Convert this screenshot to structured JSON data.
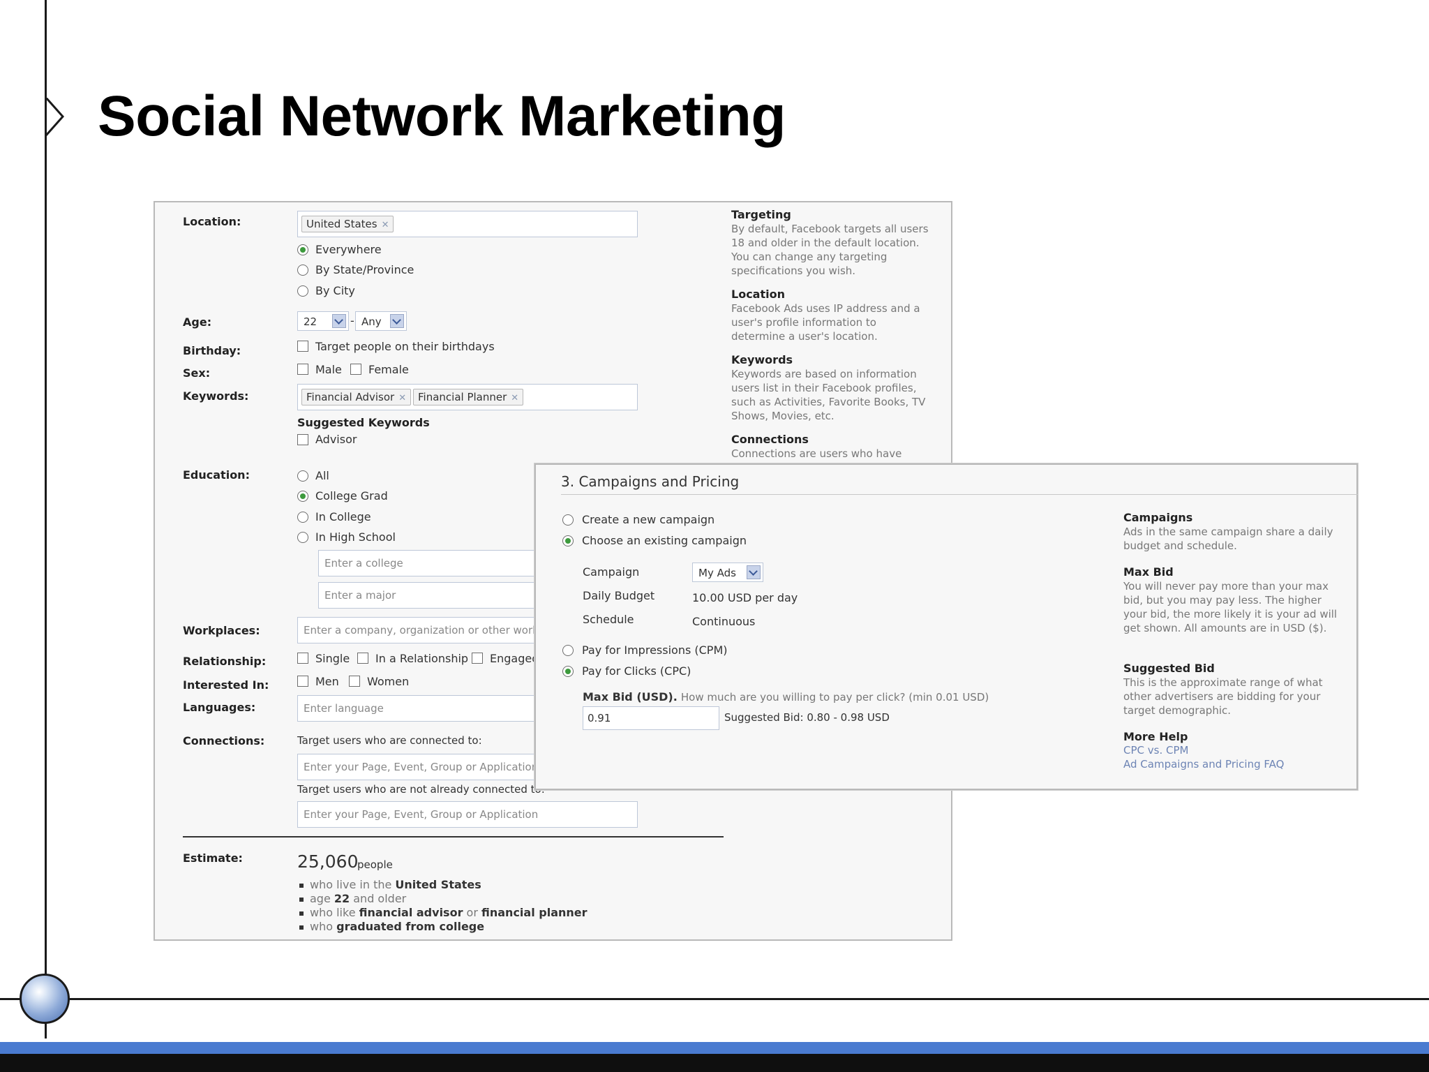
{
  "slide": {
    "title": "Social Network Marketing"
  },
  "targeting": {
    "location_label": "Location:",
    "location_token": "United States",
    "location_options": [
      "Everywhere",
      "By State/Province",
      "By City"
    ],
    "location_selected": "Everywhere",
    "age_label": "Age:",
    "age_from": "22",
    "age_sep": "-",
    "age_to": "Any",
    "birthday_label": "Birthday:",
    "birthday_option": "Target people on their birthdays",
    "sex_label": "Sex:",
    "sex_options": [
      "Male",
      "Female"
    ],
    "keywords_label": "Keywords:",
    "keyword_tokens": [
      "Financial Advisor",
      "Financial Planner"
    ],
    "suggested_heading": "Suggested Keywords",
    "suggested_option": "Advisor",
    "education_label": "Education:",
    "education_options": [
      "All",
      "College Grad",
      "In College",
      "In High School"
    ],
    "education_selected": "College Grad",
    "college_placeholder": "Enter a college",
    "major_placeholder": "Enter a major",
    "workplaces_label": "Workplaces:",
    "workplaces_placeholder": "Enter a company, organization or other workp",
    "relationship_label": "Relationship:",
    "relationship_options": [
      "Single",
      "In a Relationship",
      "Engaged"
    ],
    "interested_label": "Interested In:",
    "interested_options": [
      "Men",
      "Women"
    ],
    "languages_label": "Languages:",
    "languages_placeholder": "Enter language",
    "connections_label": "Connections:",
    "connected_text": "Target users who are connected to:",
    "connected_placeholder": "Enter your Page, Event, Group or Application",
    "not_connected_text": "Target users who are not already connected to:",
    "not_connected_placeholder": "Enter your Page, Event, Group or Application",
    "estimate_label": "Estimate:",
    "estimate_count": "25,060",
    "estimate_unit": "people",
    "estimate_lines": [
      {
        "pre": "who live in the ",
        "bold": "United States",
        "mid": "",
        "bold2": ""
      },
      {
        "pre": "age ",
        "bold": "22",
        "mid": " and older",
        "bold2": ""
      },
      {
        "pre": "who like ",
        "bold": "financial advisor",
        "mid": " or ",
        "bold2": "financial planner"
      },
      {
        "pre": "who ",
        "bold": "graduated from college",
        "mid": "",
        "bold2": ""
      }
    ],
    "help": [
      {
        "title": "Targeting",
        "text": "By default, Facebook targets all users 18 and older in the default location. You can change any targeting specifications you wish."
      },
      {
        "title": "Location",
        "text": "Facebook Ads uses IP address and a user's profile information to determine a user's location."
      },
      {
        "title": "Keywords",
        "text": "Keywords are based on information users list in their Facebook profiles, such as Activities, Favorite Books, TV Shows, Movies, etc."
      },
      {
        "title": "Connections",
        "text": "Connections are users who have"
      }
    ]
  },
  "campaign": {
    "heading": "3. Campaigns and Pricing",
    "campaign_options": [
      "Create a new campaign",
      "Choose an existing campaign"
    ],
    "campaign_selected": "Choose an existing campaign",
    "campaign_label": "Campaign",
    "campaign_value": "My Ads",
    "budget_label": "Daily Budget",
    "budget_value": "10.00 USD per day",
    "schedule_label": "Schedule",
    "schedule_value": "Continuous",
    "pricing_options": [
      "Pay for Impressions (CPM)",
      "Pay for Clicks (CPC)"
    ],
    "pricing_selected": "Pay for Clicks (CPC)",
    "maxbid_label": "Max Bid (USD).",
    "maxbid_hint": "How much are you willing to pay per click? (min 0.01 USD)",
    "maxbid_value": "0.91",
    "suggested_bid": "Suggested Bid: 0.80 - 0.98 USD",
    "help": [
      {
        "title": "Campaigns",
        "text": "Ads in the same campaign share a daily budget and schedule."
      },
      {
        "title": "Max Bid",
        "text": "You will never pay more than your max bid, but you may pay less. The higher your bid, the more likely it is your ad will get shown. All amounts are in USD ($)."
      },
      {
        "title": "Suggested Bid",
        "text": "This is the approximate range of what other advertisers are bidding for your target demographic."
      },
      {
        "title": "More Help",
        "text": ""
      }
    ],
    "links": [
      "CPC vs. CPM",
      "Ad Campaigns and Pricing FAQ"
    ]
  }
}
